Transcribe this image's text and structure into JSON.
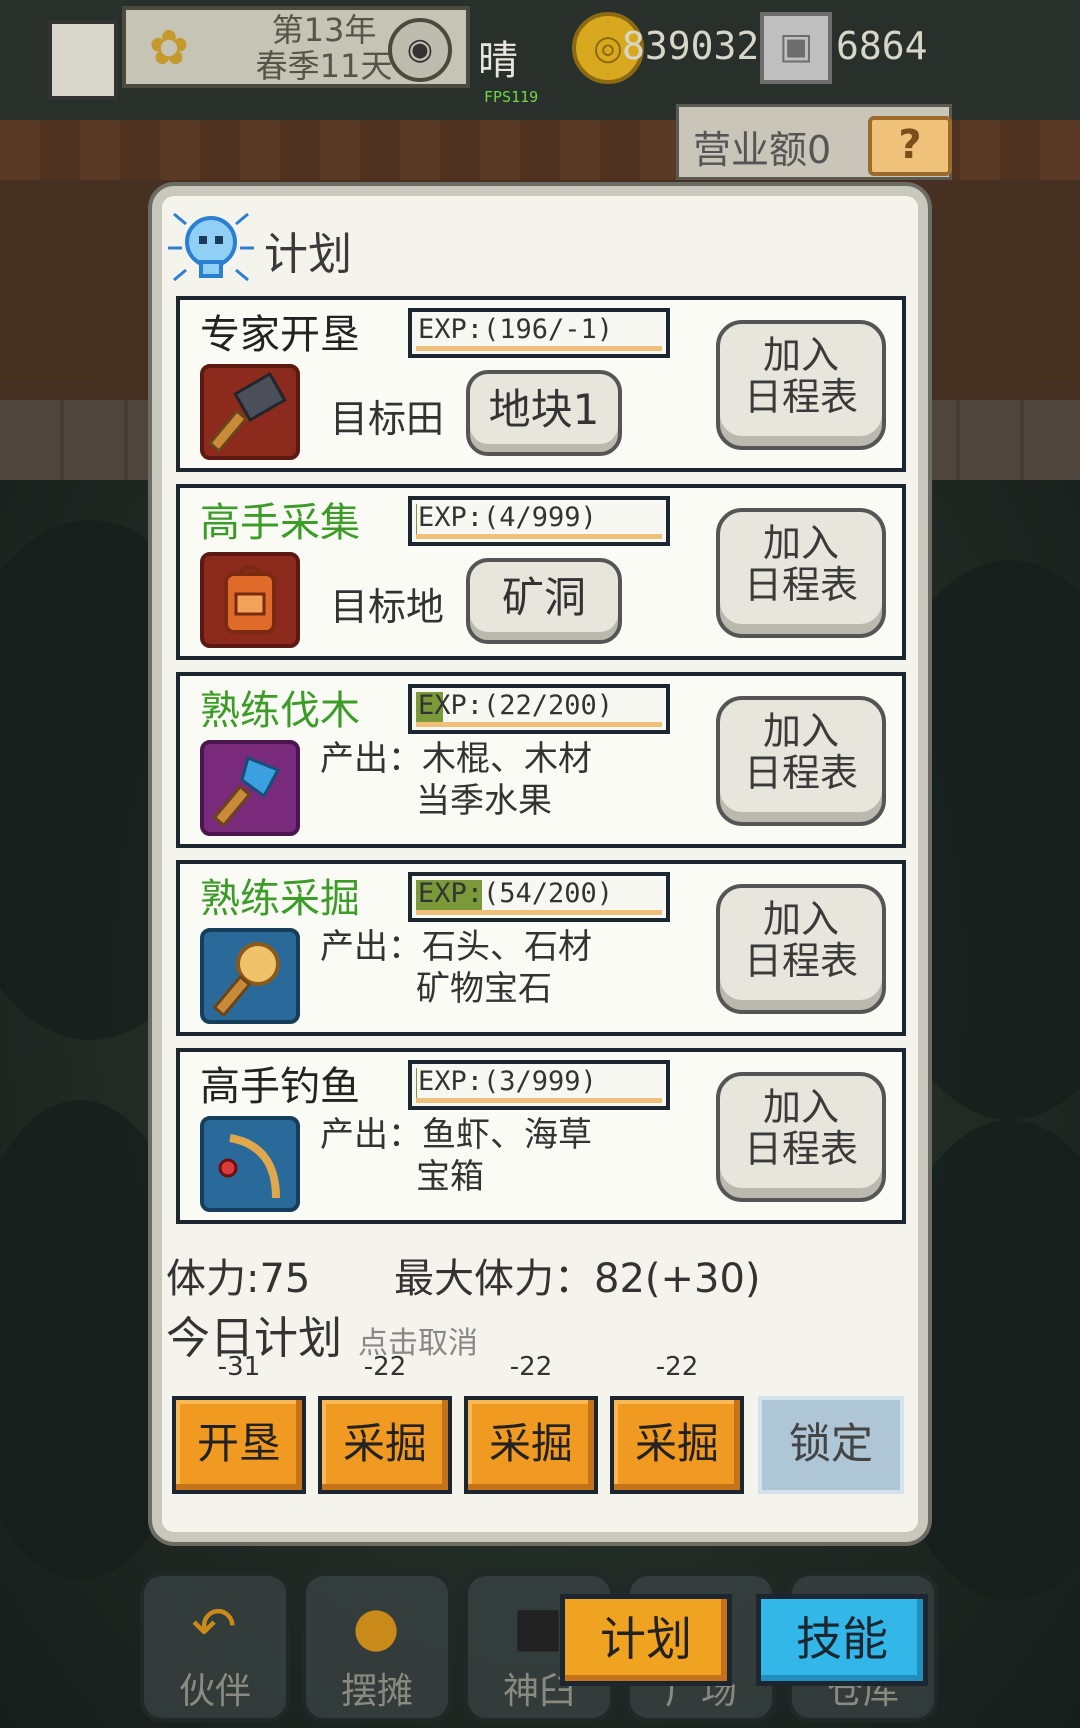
{
  "hud": {
    "date_line1": "第13年",
    "date_line2": "春季11天",
    "weather": "晴",
    "fps": "FPS119",
    "coins": "839032",
    "gems": "6864",
    "revenue": "营业额0",
    "help": "?"
  },
  "panel": {
    "title": "计划",
    "cards": [
      {
        "name": "专家开垦",
        "name_color": "black",
        "exp": "EXP:(196/-1)",
        "exp_fill": 0.0,
        "target_label": "目标田",
        "target_value": "地块1",
        "add_line1": "加入",
        "add_line2": "日程表",
        "icon": "hammer-icon"
      },
      {
        "name": "高手采集",
        "name_color": "green",
        "exp": "EXP:(4/999)",
        "exp_fill": 0.004,
        "target_label": "目标地",
        "target_value": "矿洞",
        "add_line1": "加入",
        "add_line2": "日程表",
        "icon": "backpack-icon"
      },
      {
        "name": "熟练伐木",
        "name_color": "green",
        "exp": "EXP:(22/200)",
        "exp_fill": 0.11,
        "output_line1": "产出：木棍、木材",
        "output_line2": "当季水果",
        "add_line1": "加入",
        "add_line2": "日程表",
        "icon": "axe-icon"
      },
      {
        "name": "熟练采掘",
        "name_color": "green",
        "exp": "EXP:(54/200)",
        "exp_fill": 0.27,
        "output_line1": "产出：石头、石材",
        "output_line2": "矿物宝石",
        "add_line1": "加入",
        "add_line2": "日程表",
        "icon": "pickaxe-icon"
      },
      {
        "name": "高手钓鱼",
        "name_color": "black",
        "exp": "EXP:(3/999)",
        "exp_fill": 0.003,
        "output_line1": "产出：鱼虾、海草",
        "output_line2": "宝箱",
        "add_line1": "加入",
        "add_line2": "日程表",
        "icon": "fishing-rod-icon"
      }
    ],
    "stamina": "体力:75",
    "max_stamina": "最大体力：82(+30)",
    "today_title": "今日计划",
    "today_hint": "点击取消",
    "plan_slots": [
      {
        "cost": "-31",
        "label": "开垦"
      },
      {
        "cost": "-22",
        "label": "采掘"
      },
      {
        "cost": "-22",
        "label": "采掘"
      },
      {
        "cost": "-22",
        "label": "采掘"
      }
    ],
    "lock": "锁定"
  },
  "bottom_nav": {
    "items": [
      "伙伴",
      "摆摊",
      "神臼",
      "广场",
      "仓库"
    ],
    "tab_plan": "计划",
    "tab_skill": "技能"
  },
  "colors": {
    "accent_orange": "#f09a22",
    "accent_blue": "#32b7e8",
    "green_text": "#3c9c28",
    "exp_fill": "#7a9a3a"
  }
}
